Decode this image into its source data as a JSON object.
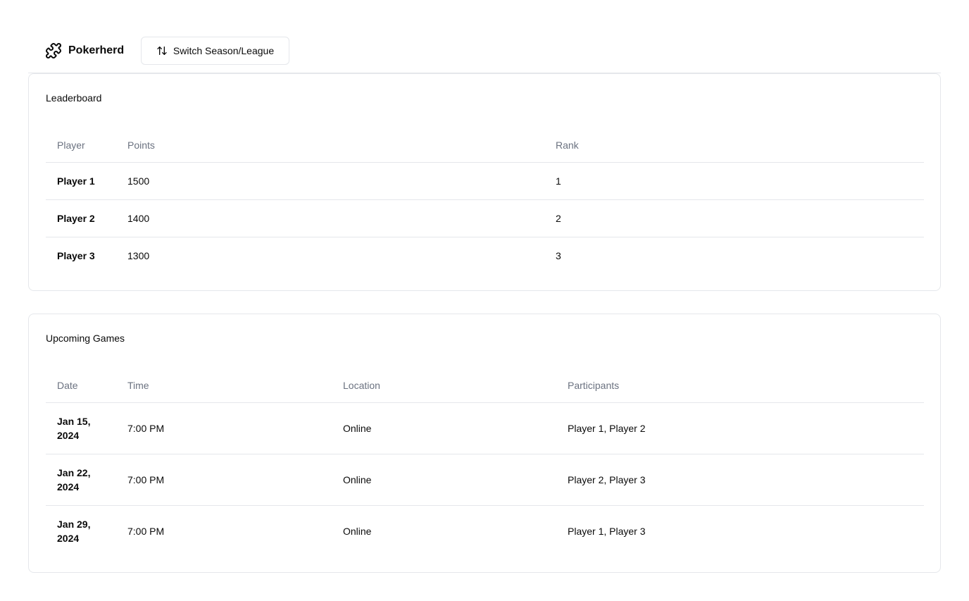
{
  "header": {
    "app_name": "Pokerherd",
    "switch_label": "Switch Season/League"
  },
  "leaderboard": {
    "title": "Leaderboard",
    "columns": [
      "Player",
      "Points",
      "Rank"
    ],
    "rows": [
      {
        "player": "Player 1",
        "points": "1500",
        "rank": "1"
      },
      {
        "player": "Player 2",
        "points": "1400",
        "rank": "2"
      },
      {
        "player": "Player 3",
        "points": "1300",
        "rank": "3"
      }
    ]
  },
  "games": {
    "title": "Upcoming Games",
    "columns": [
      "Date",
      "Time",
      "Location",
      "Participants"
    ],
    "rows": [
      {
        "date": "Jan 15, 2024",
        "time": "7:00 PM",
        "location": "Online",
        "participants": "Player 1, Player 2"
      },
      {
        "date": "Jan 22, 2024",
        "time": "7:00 PM",
        "location": "Online",
        "participants": "Player 2, Player 3"
      },
      {
        "date": "Jan 29, 2024",
        "time": "7:00 PM",
        "location": "Online",
        "participants": "Player 1, Player 3"
      }
    ]
  },
  "icons": {
    "brand": "puzzle-piece-icon",
    "switch": "arrow-up-down-icon"
  },
  "colors": {
    "border": "#e5e7eb",
    "muted_text": "#6b7280",
    "text": "#0a0a0a"
  }
}
